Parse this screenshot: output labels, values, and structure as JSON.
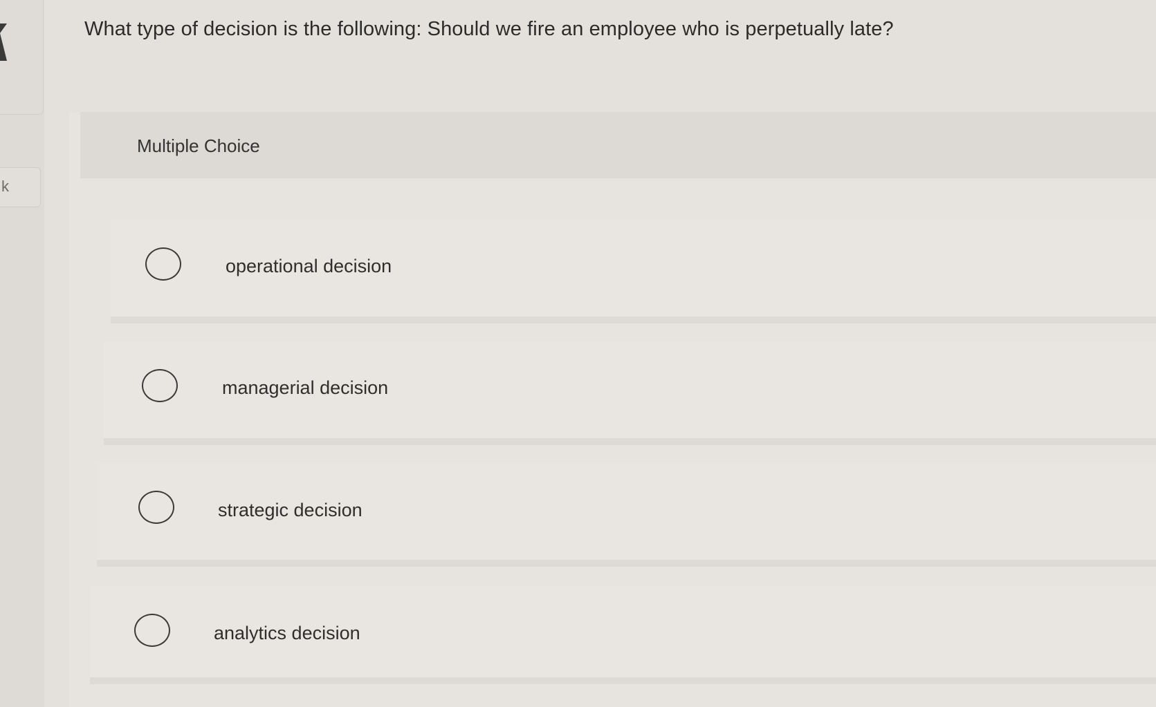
{
  "question": {
    "text": "What type of decision is the following: Should we fire an employee who is perpetually late?"
  },
  "sidebar": {
    "bookmark_text": "k"
  },
  "quiz": {
    "type_label": "Multiple Choice",
    "options": [
      {
        "label": "operational decision",
        "selected": false
      },
      {
        "label": "managerial decision",
        "selected": false
      },
      {
        "label": "strategic decision",
        "selected": false
      },
      {
        "label": "analytics decision",
        "selected": false
      }
    ]
  },
  "colors": {
    "background": "#e4e1dc",
    "text": "#2b2b2b",
    "radio_border": "#3a3a3a"
  }
}
